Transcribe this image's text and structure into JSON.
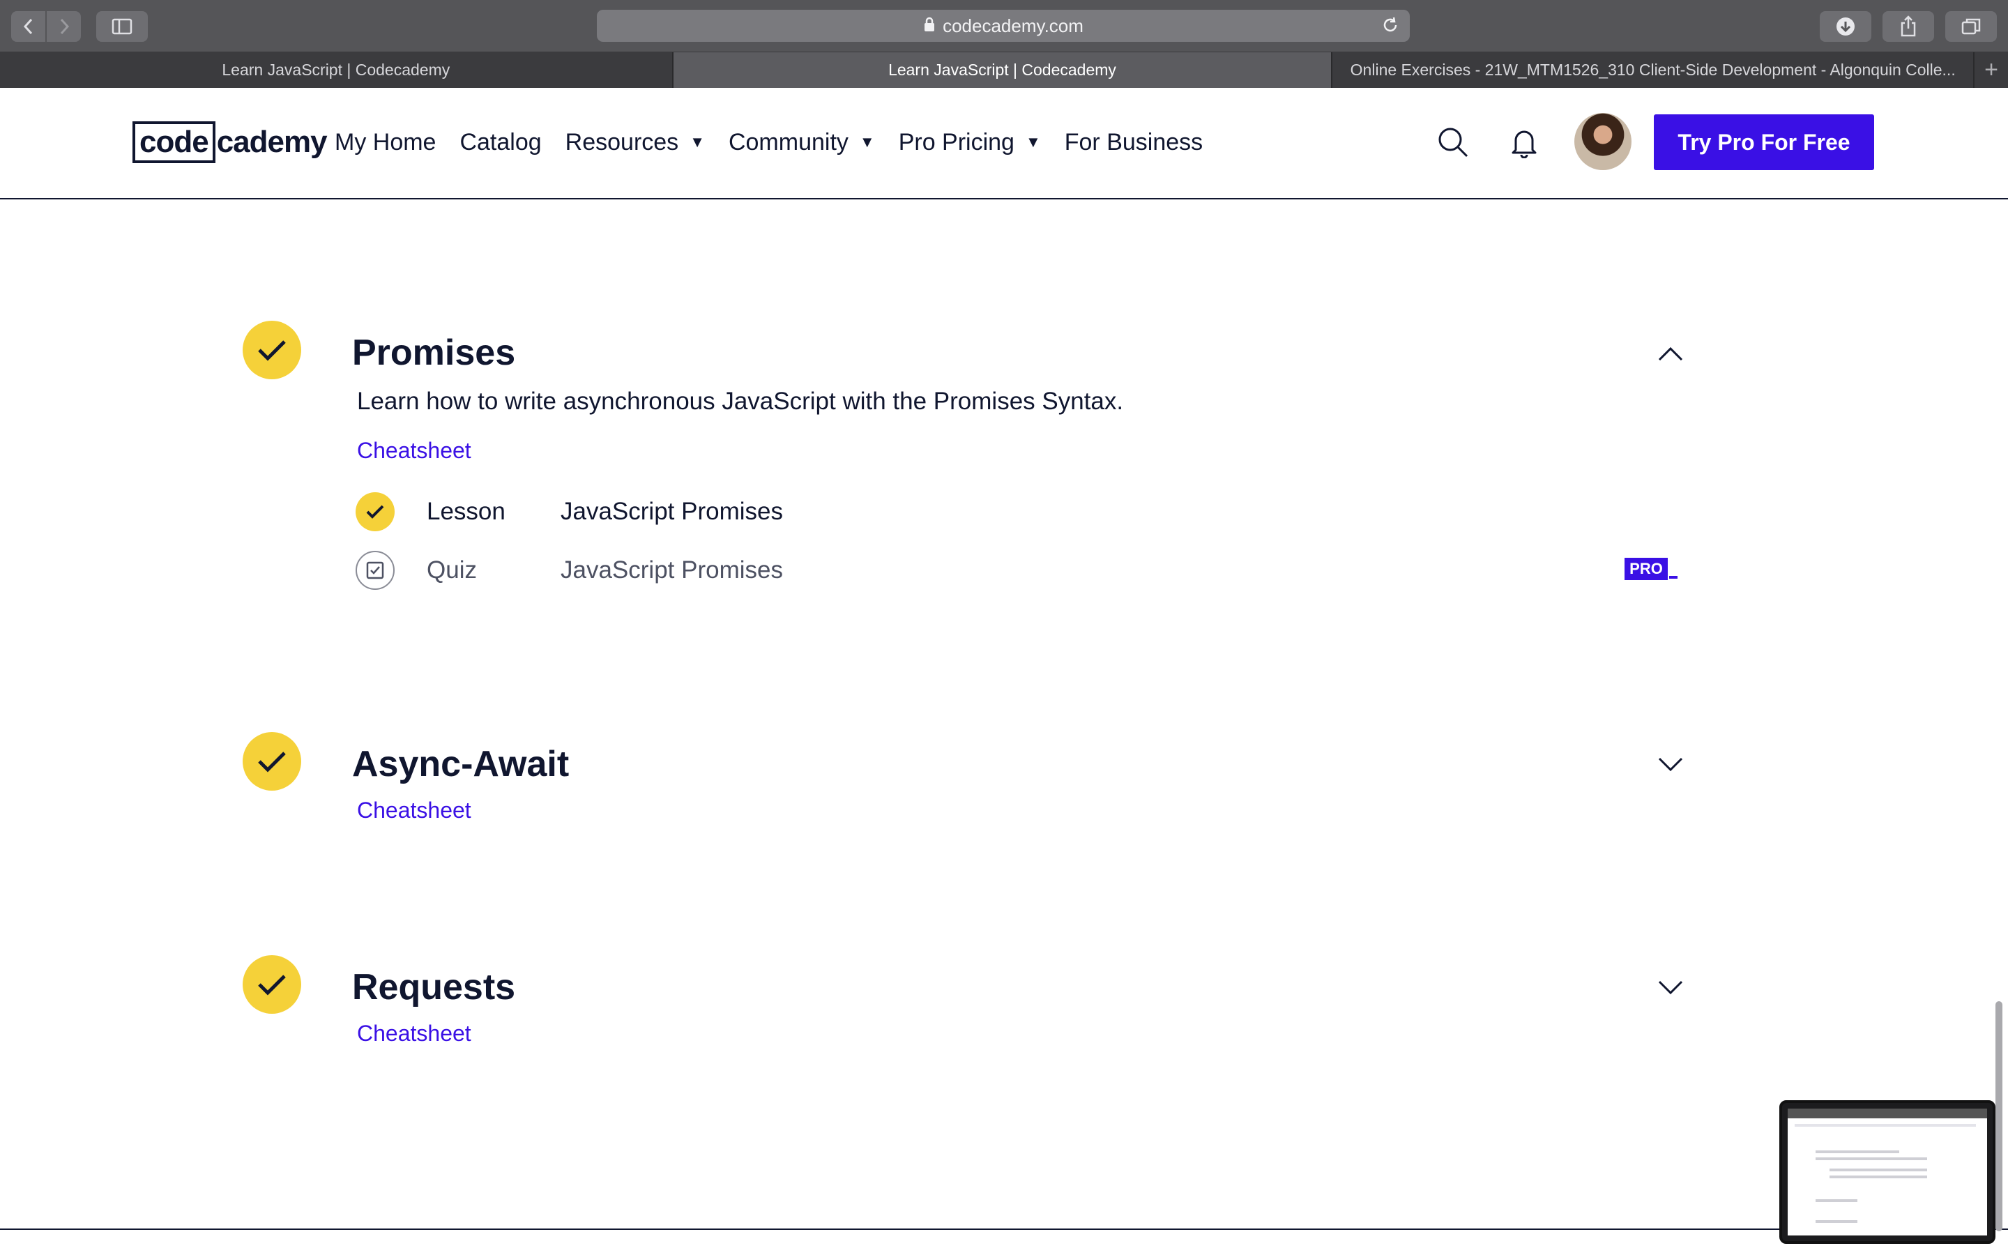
{
  "browser": {
    "url": "codecademy.com",
    "tabs": [
      {
        "title": "Learn JavaScript | Codecademy",
        "active": false
      },
      {
        "title": "Learn JavaScript | Codecademy",
        "active": true
      },
      {
        "title": "Online Exercises - 21W_MTM1526_310 Client-Side Development - Algonquin Colle...",
        "active": false
      }
    ],
    "icons": [
      "back-icon",
      "forward-icon",
      "sidebar-icon",
      "lock-icon",
      "reload-icon",
      "download-icon",
      "share-icon",
      "tabs-overview-icon",
      "new-tab-icon"
    ]
  },
  "header": {
    "logo_box": "code",
    "logo_rest": "cademy",
    "nav": [
      {
        "label": "My Home",
        "dropdown": false
      },
      {
        "label": "Catalog",
        "dropdown": false
      },
      {
        "label": "Resources",
        "dropdown": true
      },
      {
        "label": "Community",
        "dropdown": true
      },
      {
        "label": "Pro Pricing",
        "dropdown": true
      },
      {
        "label": "For Business",
        "dropdown": false
      }
    ],
    "cta_label": "Try Pro For Free",
    "colors": {
      "brand": "#3a10e5",
      "ink": "#10162f",
      "yellow": "#f5d139"
    }
  },
  "modules": [
    {
      "title": "Promises",
      "description": "Learn how to write asynchronous JavaScript with the Promises Syntax.",
      "cheatsheet": "Cheatsheet",
      "expanded": true,
      "items": [
        {
          "kind": "Lesson",
          "name": "JavaScript Promises",
          "completed": true
        },
        {
          "kind": "Quiz",
          "name": "JavaScript Promises",
          "completed": false,
          "badge": "PRO"
        }
      ]
    },
    {
      "title": "Async-Await",
      "cheatsheet": "Cheatsheet",
      "expanded": false
    },
    {
      "title": "Requests",
      "cheatsheet": "Cheatsheet",
      "expanded": false
    }
  ]
}
